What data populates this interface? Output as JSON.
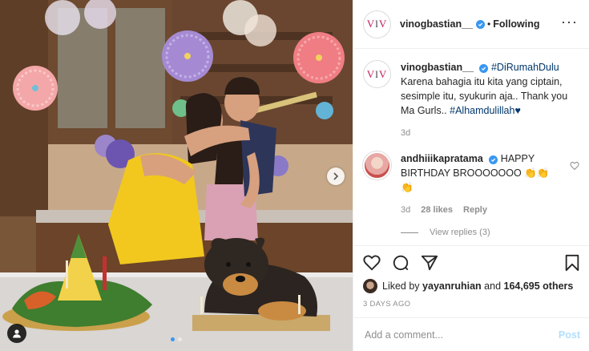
{
  "post": {
    "username": "vinogbastian__",
    "follow_status": "Following",
    "avatar_letters": [
      "V",
      "l",
      "V"
    ]
  },
  "caption": {
    "username": "vinogbastian__",
    "hashtag1": "#DiRumahDulu",
    "text": "Karena bahagia itu kita yang ciptain, sesimple itu, syukurin aja.. Thank you Ma Gurls.. ",
    "hashtag2": "#Alhamdulillah",
    "heart": "♥",
    "time": "3d"
  },
  "comment": {
    "username": "andhiiikapratama",
    "text": "HAPPY BIRTHDAY BROOOOOOO 👏👏👏",
    "time": "3d",
    "likes": "28 likes",
    "reply_label": "Reply",
    "view_replies": "View replies (3)"
  },
  "likes": {
    "liked_by_prefix": "Liked by ",
    "liker": "yayanruhian",
    "and": " and ",
    "others": "164,695 others"
  },
  "timestamp": "3 DAYS AGO",
  "add_comment": {
    "placeholder": "Add a comment...",
    "post_label": "Post"
  },
  "carousel": {
    "slide_count": 2,
    "active_index": 0
  },
  "colors": {
    "accent": "#3897f0",
    "post_disabled": "#b2dffc",
    "muted": "#8e8e8e"
  }
}
